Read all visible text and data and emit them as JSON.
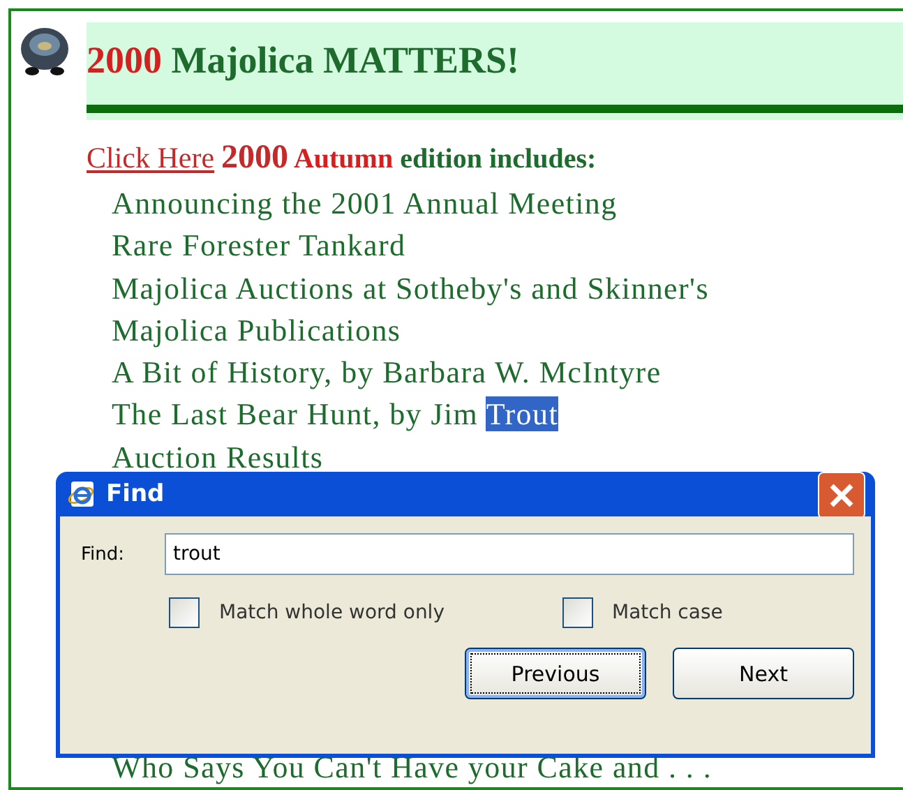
{
  "header": {
    "year": "2000",
    "title": "Majolica MATTERS!"
  },
  "intro": {
    "link": "Click Here",
    "year": "2000",
    "season": "Autumn",
    "text": "edition includes:"
  },
  "articles": [
    {
      "text": "Announcing the 2001 Annual Meeting"
    },
    {
      "text": "Rare Forester Tankard"
    },
    {
      "text": "Majolica Auctions at Sotheby's and Skinner's"
    },
    {
      "text": "Majolica Publications"
    },
    {
      "text": "A Bit of History, by Barbara W. McIntyre"
    },
    {
      "text": "The Last Bear Hunt, by Jim ",
      "highlight": "Trout"
    },
    {
      "text": "Auction Results"
    },
    {
      "text": "Who Says You Can't Have your Cake and . . .",
      "kind": "gap"
    }
  ],
  "find_dialog": {
    "title": "Find",
    "field_label": "Find:",
    "value": "trout",
    "options": [
      {
        "label": "Match whole word only",
        "checked": false
      },
      {
        "label": "Match case",
        "checked": false
      }
    ],
    "buttons": [
      {
        "label": "Previous",
        "focused": true
      },
      {
        "label": "Next",
        "focused": false
      }
    ]
  }
}
